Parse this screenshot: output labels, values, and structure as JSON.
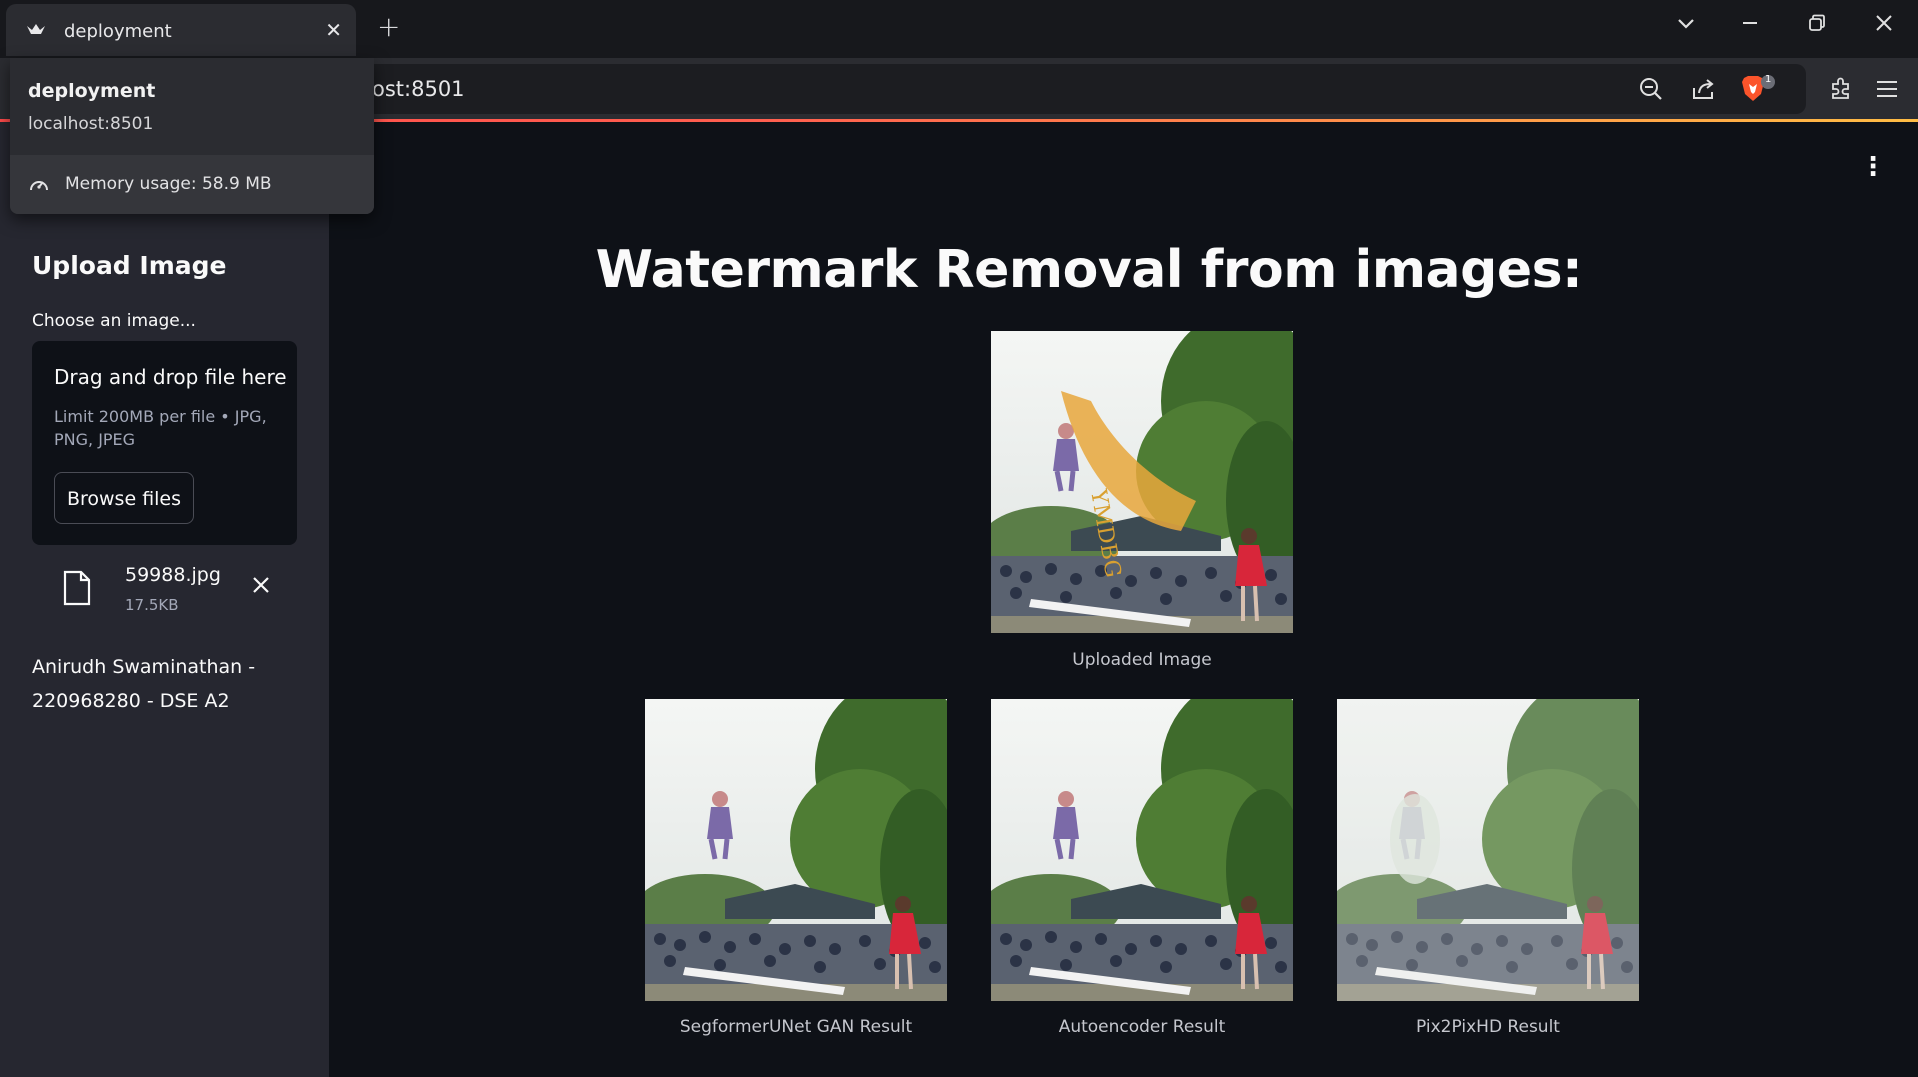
{
  "browser": {
    "tab_title": "deployment",
    "url_visible": "ost:8501",
    "extension_badge": "1"
  },
  "hover_card": {
    "title": "deployment",
    "url": "localhost:8501",
    "memory": "Memory usage: 58.9 MB"
  },
  "sidebar": {
    "heading": "Upload Image",
    "uploader_label": "Choose an image...",
    "dropzone_title": "Drag and drop file here",
    "dropzone_limit": "Limit 200MB per file • JPG, PNG, JPEG",
    "browse_label": "Browse files",
    "file_name": "59988.jpg",
    "file_size": "17.5KB",
    "author": "Anirudh Swaminathan - 220968280 - DSE A2"
  },
  "main": {
    "title": "Watermark Removal from images:",
    "uploaded_caption": "Uploaded Image",
    "watermark_text": "YMDBG",
    "results": [
      {
        "caption": "SegformerUNet GAN Result"
      },
      {
        "caption": "Autoencoder Result"
      },
      {
        "caption": "Pix2PixHD Result"
      }
    ]
  },
  "colors": {
    "app_bg": "#0e1117",
    "sidebar_bg": "#262730",
    "accent_red": "#ff4b4b",
    "brave_orange": "#fb542b"
  }
}
